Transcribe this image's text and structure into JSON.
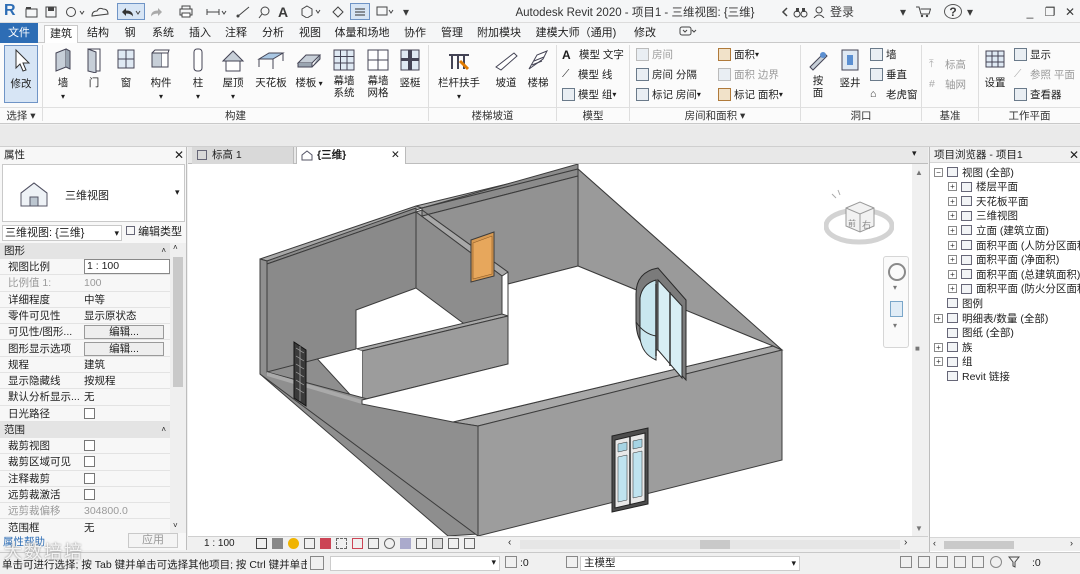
{
  "title_bar": {
    "title": "Autodesk Revit 2020 - 项目1 - 三维视图: {三维}",
    "app_letter": "R",
    "login": "登录",
    "help": "?",
    "minimize": "_",
    "restore": "❐",
    "close": "✕"
  },
  "ribbon_tabs": [
    "文件",
    "建筑",
    "结构",
    "钢",
    "系统",
    "插入",
    "注释",
    "分析",
    "视图",
    "体量和场地",
    "协作",
    "管理",
    "附加模块",
    "建模大师（通用)",
    "修改"
  ],
  "ribbon": {
    "modify": "修改",
    "select": "选择",
    "build": {
      "items": [
        "墙",
        "门",
        "窗",
        "构件",
        "柱",
        "屋顶",
        "天花板",
        "楼板",
        "幕墙\n系统",
        "幕墙\n网格",
        "竖梃"
      ],
      "title": "构建"
    },
    "circulation": {
      "items": [
        "栏杆扶手",
        "坡道",
        "楼梯"
      ],
      "title": "楼梯坡道"
    },
    "model": {
      "items": [
        "模型 文字",
        "模型 线",
        "模型 组"
      ],
      "title": "模型"
    },
    "room_area": {
      "items": [
        "房间",
        "房间 分隔",
        "标记 房间",
        "面积",
        "面积 边界",
        "标记 面积"
      ],
      "title": "房间和面积"
    },
    "opening": {
      "items": [
        "按\n面",
        "竖井",
        "墙",
        "垂直",
        "老虎窗"
      ],
      "title": "洞口"
    },
    "datum": {
      "items": [
        "标高",
        "轴网"
      ],
      "title": "基准"
    },
    "workplane": {
      "items": [
        "设置",
        "显示",
        "参照 平面",
        "查看器"
      ],
      "title": "工作平面"
    }
  },
  "properties": {
    "header": "属性",
    "type_name": "三维视图",
    "view_selector": "三维视图: {三维}",
    "edit_type": "编辑类型",
    "groups": [
      {
        "name": "图形",
        "rows": [
          {
            "k": "视图比例",
            "v": "1 : 100",
            "kind": "input"
          },
          {
            "k": "比例值 1:",
            "v": "100",
            "kind": "grey"
          },
          {
            "k": "详细程度",
            "v": "中等",
            "kind": "text"
          },
          {
            "k": "零件可见性",
            "v": "显示原状态",
            "kind": "text"
          },
          {
            "k": "可见性/图形...",
            "v": "编辑...",
            "kind": "button"
          },
          {
            "k": "图形显示选项",
            "v": "编辑...",
            "kind": "button"
          },
          {
            "k": "规程",
            "v": "建筑",
            "kind": "text"
          },
          {
            "k": "显示隐藏线",
            "v": "按规程",
            "kind": "text"
          },
          {
            "k": "默认分析显示...",
            "v": "无",
            "kind": "text"
          },
          {
            "k": "日光路径",
            "v": "",
            "kind": "check"
          }
        ]
      },
      {
        "name": "范围",
        "rows": [
          {
            "k": "裁剪视图",
            "v": "",
            "kind": "check"
          },
          {
            "k": "裁剪区域可见",
            "v": "",
            "kind": "check"
          },
          {
            "k": "注释裁剪",
            "v": "",
            "kind": "check"
          },
          {
            "k": "远剪裁激活",
            "v": "",
            "kind": "check"
          },
          {
            "k": "远剪裁偏移",
            "v": "304800.0",
            "kind": "grey"
          },
          {
            "k": "范围框",
            "v": "无",
            "kind": "text"
          }
        ]
      }
    ],
    "help_link": "属性帮助",
    "apply": "应用"
  },
  "view_tabs": [
    {
      "label": "标高 1",
      "active": false
    },
    {
      "label": "{三维}",
      "active": true
    }
  ],
  "view_bar": {
    "scale": "1 : 100"
  },
  "browser": {
    "header": "项目浏览器 - 项目1",
    "items": [
      {
        "label": "视图 (全部)",
        "level": 0,
        "exp": "−"
      },
      {
        "label": "楼层平面",
        "level": 1,
        "exp": "+"
      },
      {
        "label": "天花板平面",
        "level": 1,
        "exp": "+"
      },
      {
        "label": "三维视图",
        "level": 1,
        "exp": "+"
      },
      {
        "label": "立面 (建筑立面)",
        "level": 1,
        "exp": "+"
      },
      {
        "label": "面积平面 (人防分区面积)",
        "level": 1,
        "exp": "+"
      },
      {
        "label": "面积平面 (净面积)",
        "level": 1,
        "exp": "+"
      },
      {
        "label": "面积平面 (总建筑面积)",
        "level": 1,
        "exp": "+"
      },
      {
        "label": "面积平面 (防火分区面积)",
        "level": 1,
        "exp": "+"
      },
      {
        "label": "图例",
        "level": 0,
        "exp": ""
      },
      {
        "label": "明细表/数量 (全部)",
        "level": 0,
        "exp": "+"
      },
      {
        "label": "图纸 (全部)",
        "level": 0,
        "exp": ""
      },
      {
        "label": "族",
        "level": 0,
        "exp": "+"
      },
      {
        "label": "组",
        "level": 0,
        "exp": "+"
      },
      {
        "label": "Revit 链接",
        "level": 0,
        "exp": ""
      }
    ]
  },
  "status": {
    "message": "单击可进行选择; 按 Tab 键并单击可选择其他项目; 按 Ctrl 键并单击可",
    "workset": ":0",
    "model": "主模型",
    "filter": ":0"
  },
  "watermark": "大数培培",
  "colors": {
    "accent": "#2d6db5",
    "wall": "#8f8f8f",
    "door": "#d89a52"
  }
}
